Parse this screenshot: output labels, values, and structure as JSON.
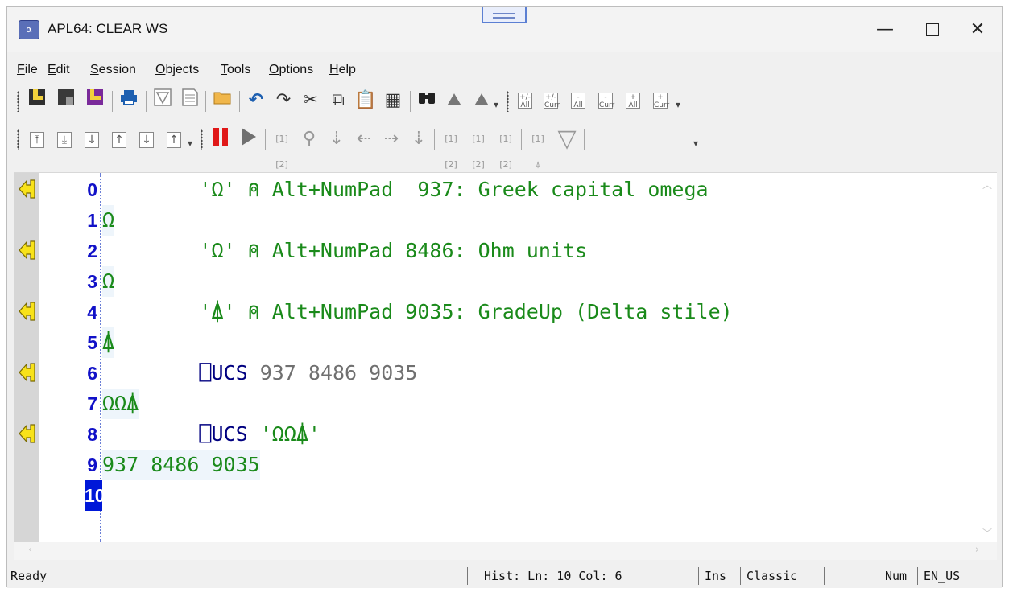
{
  "window": {
    "title": "APL64: CLEAR WS",
    "minimize_glyph": "—",
    "close_glyph": "✕"
  },
  "menu": [
    {
      "label": "File",
      "ul": "F",
      "rest": "ile"
    },
    {
      "label": "Edit",
      "ul": "E",
      "rest": "dit"
    },
    {
      "label": "Session",
      "ul": "S",
      "rest": "ession"
    },
    {
      "label": "Objects",
      "ul": "O",
      "rest": "bjects"
    },
    {
      "label": "Tools",
      "ul": "T",
      "rest": "ools"
    },
    {
      "label": "Options",
      "ul": "O",
      "rest": "ptions"
    },
    {
      "label": "Help",
      "ul": "H",
      "rest": "elp"
    }
  ],
  "toolbar1": {
    "icons": [
      "new-workspace-icon",
      "load-workspace-icon",
      "save-workspace-icon",
      "print-icon",
      "new-function-icon",
      "new-variable-icon",
      "open-folder-icon",
      "undo-icon",
      "redo-icon",
      "cut-icon",
      "copy-icon",
      "paste-icon",
      "select-all-icon",
      "find-icon",
      "find-previous-icon",
      "find-next-icon",
      "expand-all-icon",
      "expand-current-icon",
      "collapse-all-icon",
      "collapse-current-icon",
      "plus-all-icon",
      "plus-current-icon"
    ],
    "box_labels": {
      "all": "All",
      "curr": "Curr",
      "pm": "+/-",
      "minus": "-",
      "plus": "+"
    }
  },
  "toolbar2": {
    "icons": [
      "top-icon",
      "bottom-icon",
      "line-down-icon",
      "line-up-icon",
      "down-icon",
      "up-icon",
      "pause-icon",
      "run-icon",
      "step-into-icon",
      "step-over-icon",
      "step-out-icon",
      "back-icon",
      "forward-icon",
      "continue-icon",
      "run-to-cursor-icon",
      "next-line-icon",
      "step-line-icon",
      "trace-icon",
      "stop-icon"
    ],
    "small_labels": {
      "one": "[1]",
      "two": "[2]"
    }
  },
  "session": {
    "lines": [
      {
        "n": "0",
        "input": true,
        "q": "'Ω'",
        "rest": " ⍝ Alt+NumPad  937: Greek capital omega"
      },
      {
        "n": "1",
        "input": false,
        "out": "Ω"
      },
      {
        "n": "2",
        "input": true,
        "q": "'Ω'",
        "rest": " ⍝ Alt+NumPad 8486: Ohm units"
      },
      {
        "n": "3",
        "input": false,
        "out": "Ω"
      },
      {
        "n": "4",
        "input": true,
        "q": "'⍋'",
        "rest": " ⍝ Alt+NumPad 9035: GradeUp (Delta stile)"
      },
      {
        "n": "5",
        "input": false,
        "out": "⍋"
      },
      {
        "n": "6",
        "input": true,
        "quad": "⎕UCS",
        "args": " 937 8486 9035"
      },
      {
        "n": "7",
        "input": false,
        "out": "ΩΩ⍋"
      },
      {
        "n": "8",
        "input": true,
        "quad": "⎕UCS",
        "args": " 'ΩΩ⍋'"
      },
      {
        "n": "9",
        "input": false,
        "out": "937 8486 9035"
      },
      {
        "n": "10",
        "input": false,
        "out": "",
        "active": true
      }
    ]
  },
  "status": {
    "ready": "Ready",
    "hist": "Hist: Ln: 10 Col: 6",
    "mode": "Ins",
    "keyboard": "Classic",
    "num": "Num",
    "locale": "EN_US"
  },
  "colors": {
    "line_number": "#1111c8",
    "code_green": "#1a8a1a",
    "active_line_bg": "#0018d8",
    "gutter": "#d6d6d6",
    "quad_blue": "#000080"
  }
}
